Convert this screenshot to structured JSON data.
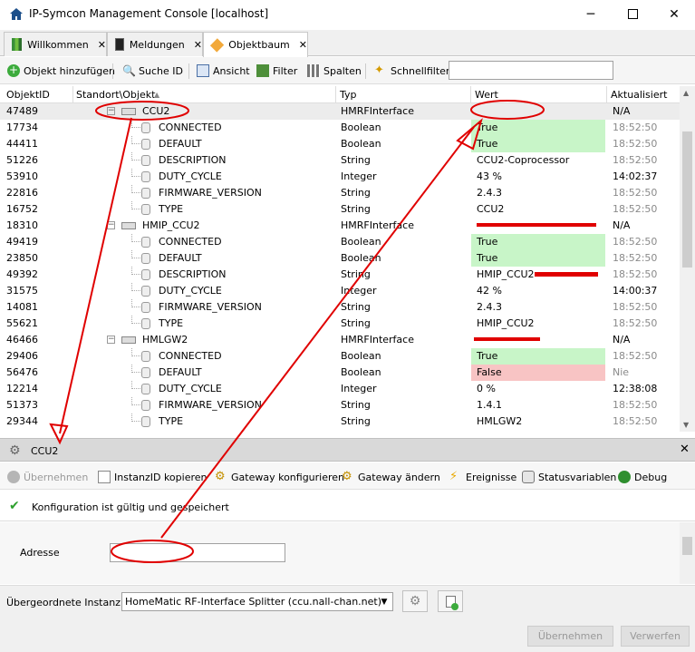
{
  "window": {
    "title": "IP-Symcon Management Console [localhost]"
  },
  "tabs": [
    {
      "label": "Willkommen"
    },
    {
      "label": "Meldungen"
    },
    {
      "label": "Objektbaum"
    }
  ],
  "toolbar": {
    "add_object": "Objekt hinzufügen",
    "search_id": "Suche ID",
    "view": "Ansicht",
    "filter": "Filter",
    "columns": "Spalten",
    "quick_filter": "Schnellfilter",
    "quick_filter_value": ""
  },
  "grid": {
    "columns": [
      "ObjektID",
      "Standort\\Objekt",
      "Typ",
      "Wert",
      "Aktualisiert"
    ],
    "rows": [
      {
        "id": "47489",
        "name": "CCU2",
        "type": "HMRFInterface",
        "value": "",
        "updated": "N/A"
      },
      {
        "id": "17734",
        "name": "CONNECTED",
        "type": "Boolean",
        "value": "True",
        "updated": "18:52:50"
      },
      {
        "id": "44411",
        "name": "DEFAULT",
        "type": "Boolean",
        "value": "True",
        "updated": "18:52:50"
      },
      {
        "id": "51226",
        "name": "DESCRIPTION",
        "type": "String",
        "value": "CCU2-Coprocessor",
        "updated": "18:52:50"
      },
      {
        "id": "53910",
        "name": "DUTY_CYCLE",
        "type": "Integer",
        "value": "43 %",
        "updated": "14:02:37"
      },
      {
        "id": "22816",
        "name": "FIRMWARE_VERSION",
        "type": "String",
        "value": "2.4.3",
        "updated": "18:52:50"
      },
      {
        "id": "16752",
        "name": "TYPE",
        "type": "String",
        "value": "CCU2",
        "updated": "18:52:50"
      },
      {
        "id": "18310",
        "name": "HMIP_CCU2",
        "type": "HMRFInterface",
        "value": "",
        "updated": "N/A"
      },
      {
        "id": "49419",
        "name": "CONNECTED",
        "type": "Boolean",
        "value": "True",
        "updated": "18:52:50"
      },
      {
        "id": "23850",
        "name": "DEFAULT",
        "type": "Boolean",
        "value": "True",
        "updated": "18:52:50"
      },
      {
        "id": "49392",
        "name": "DESCRIPTION",
        "type": "String",
        "value": "HMIP_CCU2",
        "updated": "18:52:50"
      },
      {
        "id": "31575",
        "name": "DUTY_CYCLE",
        "type": "Integer",
        "value": "42 %",
        "updated": "14:00:37"
      },
      {
        "id": "14081",
        "name": "FIRMWARE_VERSION",
        "type": "String",
        "value": "2.4.3",
        "updated": "18:52:50"
      },
      {
        "id": "55621",
        "name": "TYPE",
        "type": "String",
        "value": "HMIP_CCU2",
        "updated": "18:52:50"
      },
      {
        "id": "46466",
        "name": "HMLGW2",
        "type": "HMRFInterface",
        "value": "",
        "updated": "N/A"
      },
      {
        "id": "29406",
        "name": "CONNECTED",
        "type": "Boolean",
        "value": "True",
        "updated": "18:52:50"
      },
      {
        "id": "56476",
        "name": "DEFAULT",
        "type": "Boolean",
        "value": "False",
        "updated": "Nie"
      },
      {
        "id": "12214",
        "name": "DUTY_CYCLE",
        "type": "Integer",
        "value": "0 %",
        "updated": "12:38:08"
      },
      {
        "id": "51373",
        "name": "FIRMWARE_VERSION",
        "type": "String",
        "value": "1.4.1",
        "updated": "18:52:50"
      },
      {
        "id": "29344",
        "name": "TYPE",
        "type": "String",
        "value": "HMLGW2",
        "updated": "18:52:50"
      }
    ]
  },
  "panel": {
    "title": "CCU2",
    "actions": {
      "apply": "Übernehmen",
      "copy_id": "InstanzID kopieren",
      "configure_gateway": "Gateway konfigurieren",
      "change_gateway": "Gateway ändern",
      "events": "Ereignisse",
      "status_vars": "Statusvariablen",
      "debug": "Debug"
    },
    "status": "Konfiguration ist gültig und gespeichert",
    "address_label": "Adresse",
    "address_value": ""
  },
  "bottom": {
    "parent_label": "Übergeordnete Instanz:",
    "parent_value": "HomeMatic RF-Interface Splitter (ccu.nall-chan.net)",
    "apply": "Übernehmen",
    "discard": "Verwerfen"
  },
  "colors": {
    "true_bg": "#c8f5c8",
    "false_bg": "#f8c4c4",
    "annotation": "#e00000"
  }
}
